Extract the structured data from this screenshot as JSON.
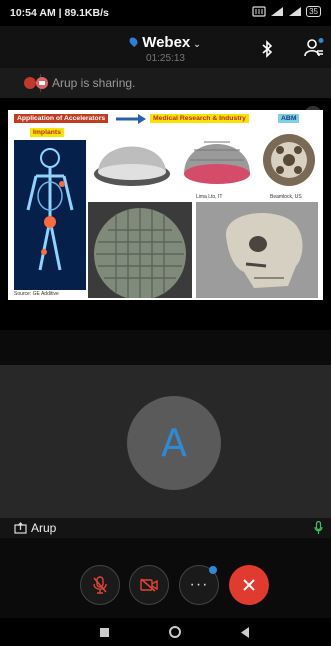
{
  "status_bar": {
    "time": "10:54 AM | 89.1KB/s",
    "battery_label": "35"
  },
  "header": {
    "app_title": "Webex",
    "call_duration": "01:25:13"
  },
  "share_banner": {
    "text": "Arup is sharing."
  },
  "slide": {
    "tags": [
      "Application of Accelerators",
      "Medical Research & Industry",
      "ABM",
      "Implants"
    ],
    "captions": [
      "Lima Lto, IT",
      "Beamlock, US",
      "Source: GE Additive"
    ]
  },
  "participant": {
    "avatar_initial": "A",
    "name": "Arup"
  },
  "colors": {
    "accent": "#2d8ad6",
    "end_call": "#e03b2e",
    "mic_active": "#3fbf5f"
  }
}
